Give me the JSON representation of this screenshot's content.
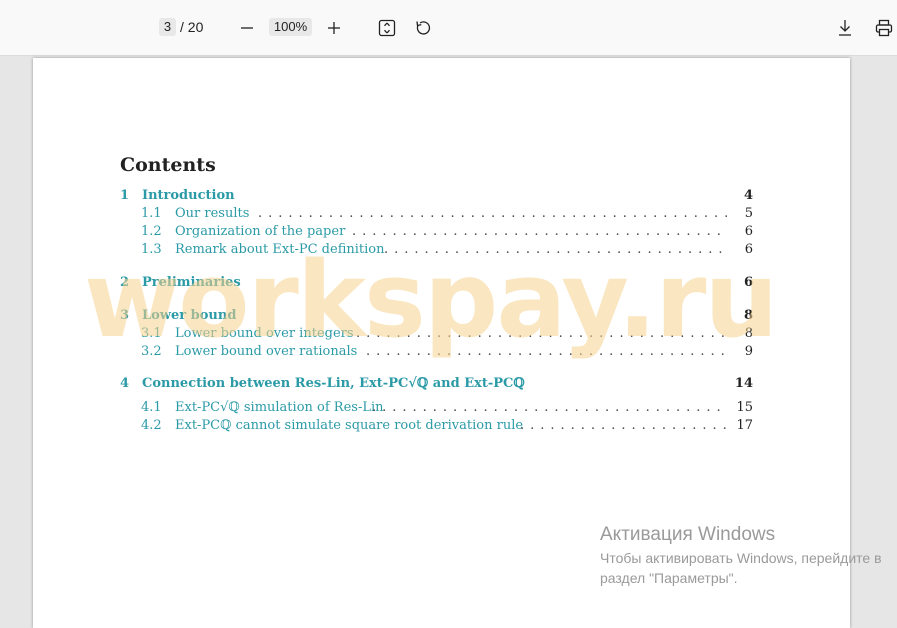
{
  "toolbar": {
    "page_current": "3",
    "page_total": "/ 20",
    "zoom": "100%",
    "icons": [
      "minus-icon",
      "plus-icon",
      "fit-page-icon",
      "rotate-icon",
      "download-icon",
      "print-icon"
    ]
  },
  "toc": {
    "heading": "Contents",
    "sections": [
      {
        "num": "1",
        "title": "Introduction",
        "page": "4",
        "subs": [
          {
            "num": "1.1",
            "title": "Our results",
            "page": "5"
          },
          {
            "num": "1.2",
            "title": "Organization of the paper",
            "page": "6"
          },
          {
            "num": "1.3",
            "title": "Remark about Ext-PC definition",
            "page": "6"
          }
        ]
      },
      {
        "num": "2",
        "title": "Preliminaries",
        "page": "6",
        "subs": []
      },
      {
        "num": "3",
        "title": "Lower bound",
        "page": "8",
        "subs": [
          {
            "num": "3.1",
            "title": "Lower bound over integers",
            "page": "8"
          },
          {
            "num": "3.2",
            "title": "Lower bound over rationals",
            "page": "9"
          }
        ]
      },
      {
        "num": "4",
        "title": "Connection between Res-Lin, Ext-PC√ℚ and Ext-PCℚ",
        "page": "14",
        "subs": [
          {
            "num": "4.1",
            "title": "Ext-PC√ℚ simulation of Res-Lin",
            "page": "15"
          },
          {
            "num": "4.2",
            "title": "Ext-PCℚ cannot simulate square root derivation rule",
            "page": "17"
          }
        ]
      }
    ]
  },
  "watermark": "workspay.ru",
  "activation": {
    "title": "Активация Windows",
    "line1": "Чтобы активировать Windows, перейдите в",
    "line2": "раздел \"Параметры\"."
  },
  "colors": {
    "link": "#2b9aa7",
    "watermark": "#f6d28c"
  }
}
